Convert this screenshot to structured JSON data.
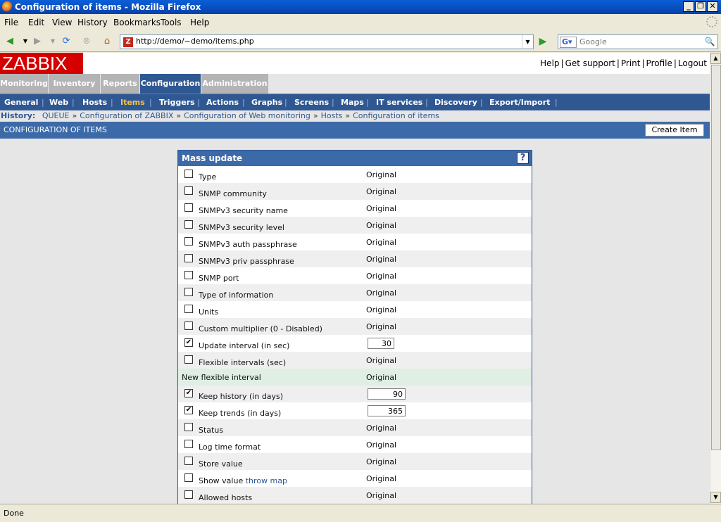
{
  "window": {
    "title": "Configuration of items - Mozilla Firefox"
  },
  "menu": [
    "File",
    "Edit",
    "View",
    "History",
    "Bookmarks",
    "Tools",
    "Help"
  ],
  "address": {
    "url": "http://demo/~demo/items.php"
  },
  "search": {
    "placeholder": "Google"
  },
  "app": {
    "logo": "ZABBIX",
    "toplinks": [
      "Help",
      "Get support",
      "Print",
      "Profile",
      "Logout"
    ],
    "tabs": [
      "Monitoring",
      "Inventory",
      "Reports",
      "Configuration",
      "Administration"
    ],
    "active_tab": "Configuration",
    "subnav": [
      "General",
      "Web",
      "Hosts",
      "Items",
      "Triggers",
      "Actions",
      "Graphs",
      "Screens",
      "Maps",
      "IT services",
      "Discovery",
      "Export/Import"
    ],
    "active_subnav": "Items",
    "history_label": "History:",
    "history": [
      "QUEUE",
      "Configuration of ZABBIX",
      "Configuration of Web monitoring",
      "Hosts",
      "Configuration of items"
    ],
    "page_title": "CONFIGURATION OF ITEMS",
    "create_button": "Create Item"
  },
  "form": {
    "title": "Mass update",
    "help": "?",
    "rows": [
      {
        "label": "Type",
        "checked": false,
        "value": "Original"
      },
      {
        "label": "SNMP community",
        "checked": false,
        "value": "Original"
      },
      {
        "label": "SNMPv3 security name",
        "checked": false,
        "value": "Original"
      },
      {
        "label": "SNMPv3 security level",
        "checked": false,
        "value": "Original"
      },
      {
        "label": "SNMPv3 auth passphrase",
        "checked": false,
        "value": "Original"
      },
      {
        "label": "SNMPv3 priv passphrase",
        "checked": false,
        "value": "Original"
      },
      {
        "label": "SNMP port",
        "checked": false,
        "value": "Original"
      },
      {
        "label": "Type of information",
        "checked": false,
        "value": "Original"
      },
      {
        "label": "Units",
        "checked": false,
        "value": "Original"
      },
      {
        "label": "Custom multiplier (0 - Disabled)",
        "checked": false,
        "value": "Original"
      },
      {
        "label": "Update interval (in sec)",
        "checked": true,
        "input": "30"
      },
      {
        "label": "Flexible intervals (sec)",
        "checked": false,
        "value": "Original"
      },
      {
        "label": "New flexible interval",
        "nocheckbox": true,
        "value": "Original"
      },
      {
        "label": "Keep history (in days)",
        "checked": true,
        "input": "90"
      },
      {
        "label": "Keep trends (in days)",
        "checked": true,
        "input": "365"
      },
      {
        "label": "Status",
        "checked": false,
        "value": "Original"
      },
      {
        "label": "Log time format",
        "checked": false,
        "value": "Original"
      },
      {
        "label": "Store value",
        "checked": false,
        "value": "Original"
      },
      {
        "label": "Show value",
        "link": "throw map",
        "checked": false,
        "value": "Original"
      },
      {
        "label": "Allowed hosts",
        "checked": false,
        "value": "Original"
      }
    ]
  },
  "statusbar": {
    "text": "Done"
  }
}
